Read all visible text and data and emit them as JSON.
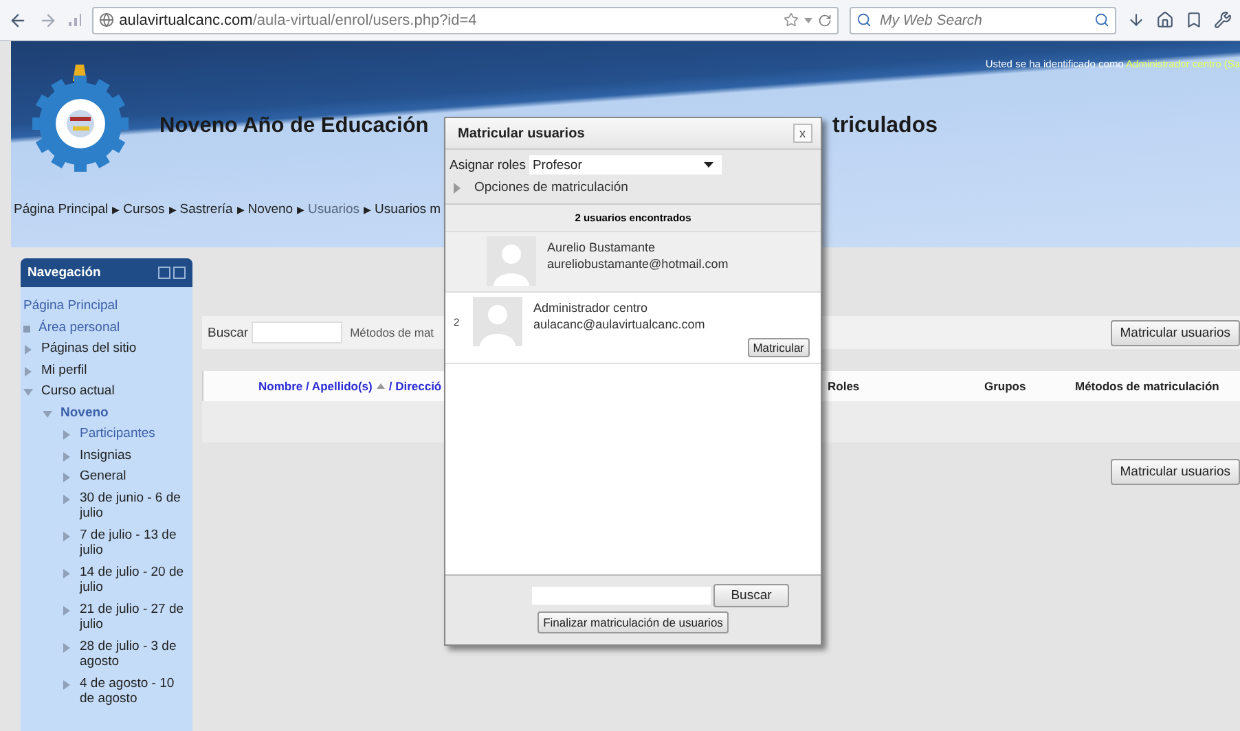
{
  "browser": {
    "url_domain": "aulavirtualcanc.com",
    "url_path": "/aula-virtual/enrol/users.php?id=4",
    "search_placeholder": "My Web Search"
  },
  "header": {
    "login_text": "Usted se ha identificado como",
    "login_user": "Administrador centro (Sa",
    "title_left": "Noveno Año de Educación",
    "title_right": "triculados"
  },
  "breadcrumb": [
    {
      "kind": "text",
      "label": "Página Principal"
    },
    {
      "kind": "separator",
      "label": "▶"
    },
    {
      "kind": "text",
      "label": "Cursos"
    },
    {
      "kind": "separator",
      "label": "▶"
    },
    {
      "kind": "text",
      "label": "Sastrería"
    },
    {
      "kind": "separator",
      "label": "▶"
    },
    {
      "kind": "text",
      "label": "Noveno"
    },
    {
      "kind": "separator",
      "label": "▶"
    },
    {
      "kind": "link",
      "label": "Usuarios"
    },
    {
      "kind": "separator",
      "label": "▶"
    },
    {
      "kind": "text",
      "label": "Usuarios m"
    }
  ],
  "navigation": {
    "title": "Navegación",
    "items": [
      {
        "kind": "plain",
        "label": "Página Principal",
        "link": true,
        "current": false
      },
      {
        "kind": "leaf",
        "label": "Área personal",
        "link": true,
        "current": false
      },
      {
        "kind": "branch",
        "label": "Páginas del sitio",
        "link": false,
        "current": false,
        "expanded": false
      },
      {
        "kind": "branch",
        "label": "Mi perfil",
        "link": false,
        "current": false,
        "expanded": false
      },
      {
        "kind": "branch",
        "label": "Curso actual",
        "link": false,
        "current": false,
        "expanded": true,
        "children": [
          {
            "kind": "branch",
            "label": "Noveno",
            "link": true,
            "current": true,
            "expanded": true,
            "children": [
              {
                "kind": "branch",
                "label": "Participantes",
                "link": true,
                "current": false,
                "expanded": false
              },
              {
                "kind": "branch",
                "label": "Insignias",
                "link": false,
                "current": false,
                "expanded": false
              },
              {
                "kind": "branch",
                "label": "General",
                "link": false,
                "current": false,
                "expanded": false
              },
              {
                "kind": "branch",
                "label": "30 de junio - 6 de julio",
                "link": false,
                "current": false,
                "expanded": false
              },
              {
                "kind": "branch",
                "label": "7 de julio - 13 de julio",
                "link": false,
                "current": false,
                "expanded": false
              },
              {
                "kind": "branch",
                "label": "14 de julio - 20 de julio",
                "link": false,
                "current": false,
                "expanded": false
              },
              {
                "kind": "branch",
                "label": "21 de julio - 27 de julio",
                "link": false,
                "current": false,
                "expanded": false
              },
              {
                "kind": "branch",
                "label": "28 de julio - 3 de agosto",
                "link": false,
                "current": false,
                "expanded": false
              },
              {
                "kind": "branch",
                "label": "4 de agosto - 10 de agosto",
                "link": false,
                "current": false,
                "expanded": false
              }
            ]
          }
        ]
      }
    ]
  },
  "filter": {
    "label": "Buscar",
    "methods_label": "Métodos de mat"
  },
  "enrol_buttons": [
    "Matricular usuarios",
    "Matricular usuarios"
  ],
  "table": {
    "name_column": {
      "label": "Nombre / Apellido(s)",
      "sorted": true,
      "rest": "/ Direcció"
    },
    "columns": [
      "Roles",
      "Grupos",
      "Métodos de matriculación"
    ]
  },
  "dialog": {
    "title": "Matricular usuarios",
    "close": "x",
    "role_label": "Asignar roles",
    "role_value": "Profesor",
    "options_label": "Opciones de matriculación",
    "options_expanded": false,
    "found": "2 usuarios encontrados",
    "users": [
      {
        "name": "Aurelio Bustamante",
        "email": "aureliobustamante@hotmail.com",
        "selected": true
      },
      {
        "number": "2",
        "name": "Administrador centro",
        "email": "aulacanc@aulavirtualcanc.com",
        "selected": false,
        "action": "Matricular"
      }
    ],
    "search_button": "Buscar",
    "finish_button": "Finalizar matriculación de usuarios"
  }
}
